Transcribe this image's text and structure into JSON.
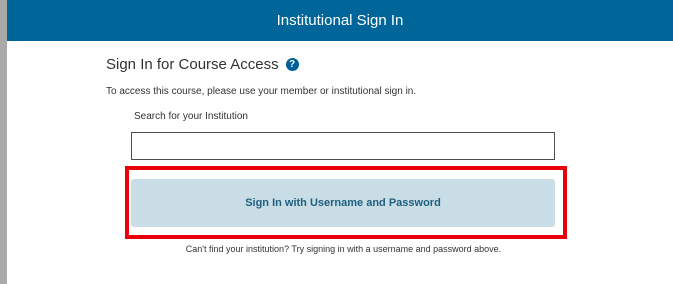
{
  "header": {
    "title": "Institutional Sign In"
  },
  "sign_in": {
    "heading": "Sign In for Course Access",
    "help_icon": "question-circle-icon",
    "help_glyph": "?",
    "description": "To access this course, please use your member or institutional sign in.",
    "search_label": "Search for your Institution",
    "search_value": "",
    "search_placeholder": "",
    "button_label": "Sign In with Username and Password",
    "footer_note": "Can't find your institution? Try signing in with a username and password above."
  },
  "colors": {
    "header_bg": "#006699",
    "button_bg": "#c9dde6",
    "button_text": "#1e5f7f",
    "highlight": "#e8000b",
    "help_icon": "#005e99"
  }
}
